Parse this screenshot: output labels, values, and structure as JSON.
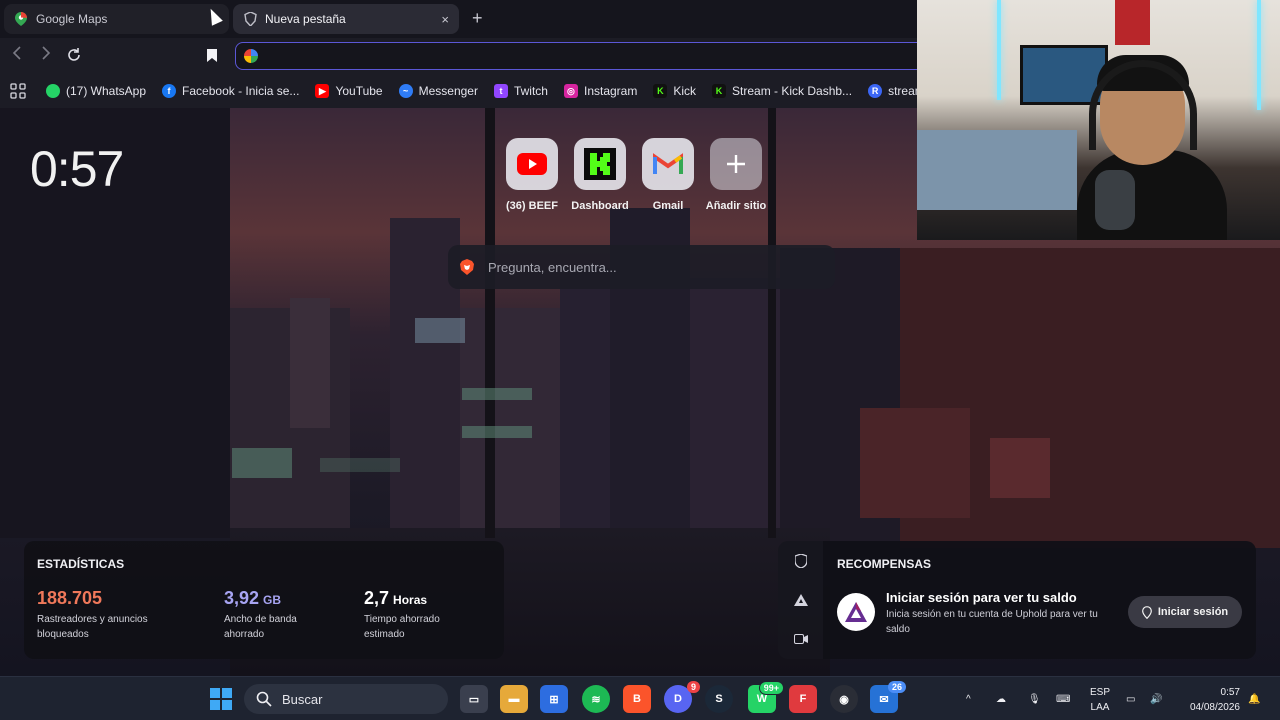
{
  "browser": {
    "tabs": [
      {
        "title": "Google Maps",
        "active": false,
        "icon": "map-pin-icon"
      },
      {
        "title": "Nueva pestaña",
        "active": true,
        "icon": "brave-shield-icon"
      }
    ],
    "new_tab": "+",
    "close_glyph": "×",
    "address": {
      "value": "",
      "icon": "google-icon"
    }
  },
  "bookmarks": [
    {
      "label": "(17) WhatsApp",
      "icon": "whatsapp-icon",
      "color": "#25d366"
    },
    {
      "label": "Facebook - Inicia se...",
      "icon": "facebook-icon",
      "color": "#1877f2"
    },
    {
      "label": "YouTube",
      "icon": "youtube-icon",
      "color": "#ff0000"
    },
    {
      "label": "Messenger",
      "icon": "messenger-icon",
      "color": "#2f7cf6"
    },
    {
      "label": "Twitch",
      "icon": "twitch-icon",
      "color": "#9146ff"
    },
    {
      "label": "Instagram",
      "icon": "instagram-icon",
      "color": "#d6249f"
    },
    {
      "label": "Kick",
      "icon": "kick-icon",
      "color": "#53fc18"
    },
    {
      "label": "Stream - Kick Dashb...",
      "icon": "kick-icon",
      "color": "#53fc18"
    },
    {
      "label": "stream tiktok",
      "icon": "r-icon",
      "color": "#3b66f5"
    }
  ],
  "newtab": {
    "clock": "0:57",
    "top_sites": [
      {
        "label": "(36) BEEF",
        "icon": "youtube-icon"
      },
      {
        "label": "Dashboard",
        "icon": "kick-icon"
      },
      {
        "label": "Gmail",
        "icon": "gmail-icon"
      },
      {
        "label": "Añadir sitio",
        "icon": "plus-icon"
      }
    ],
    "search_placeholder": "Pregunta, encuentra...",
    "stats": {
      "title": "ESTADÍSTICAS",
      "trackers": {
        "value": "188.705",
        "desc": "Rastreadores y anuncios bloqueados",
        "color": "#f0785a"
      },
      "bandwidth": {
        "value": "3,92",
        "unit": "GB",
        "desc": "Ancho de banda ahorrado",
        "color": "#a7a4f2"
      },
      "time": {
        "value": "2,7",
        "unit": "Horas",
        "desc": "Tiempo ahorrado estimado",
        "color": "#ffffff"
      }
    },
    "rewards": {
      "title": "RECOMPENSAS",
      "heading": "Iniciar sesión para ver tu saldo",
      "desc": "Inicia sesión en tu cuenta de Uphold para ver tu saldo",
      "button": "Iniciar sesión"
    }
  },
  "taskbar": {
    "search_label": "Buscar",
    "apps": [
      {
        "name": "file-explorer",
        "badge": ""
      },
      {
        "name": "store",
        "badge": ""
      },
      {
        "name": "spotify",
        "badge": ""
      },
      {
        "name": "brave",
        "badge": ""
      },
      {
        "name": "discord",
        "badge": "9"
      },
      {
        "name": "steam",
        "badge": ""
      },
      {
        "name": "whatsapp",
        "badge": "99+"
      },
      {
        "name": "obs",
        "badge": ""
      },
      {
        "name": "chrome",
        "badge": ""
      },
      {
        "name": "mail",
        "badge": "26"
      }
    ],
    "lang_top": "ESP",
    "lang_bottom": "LAA",
    "time": "0:57",
    "date": "04/08/2026"
  }
}
